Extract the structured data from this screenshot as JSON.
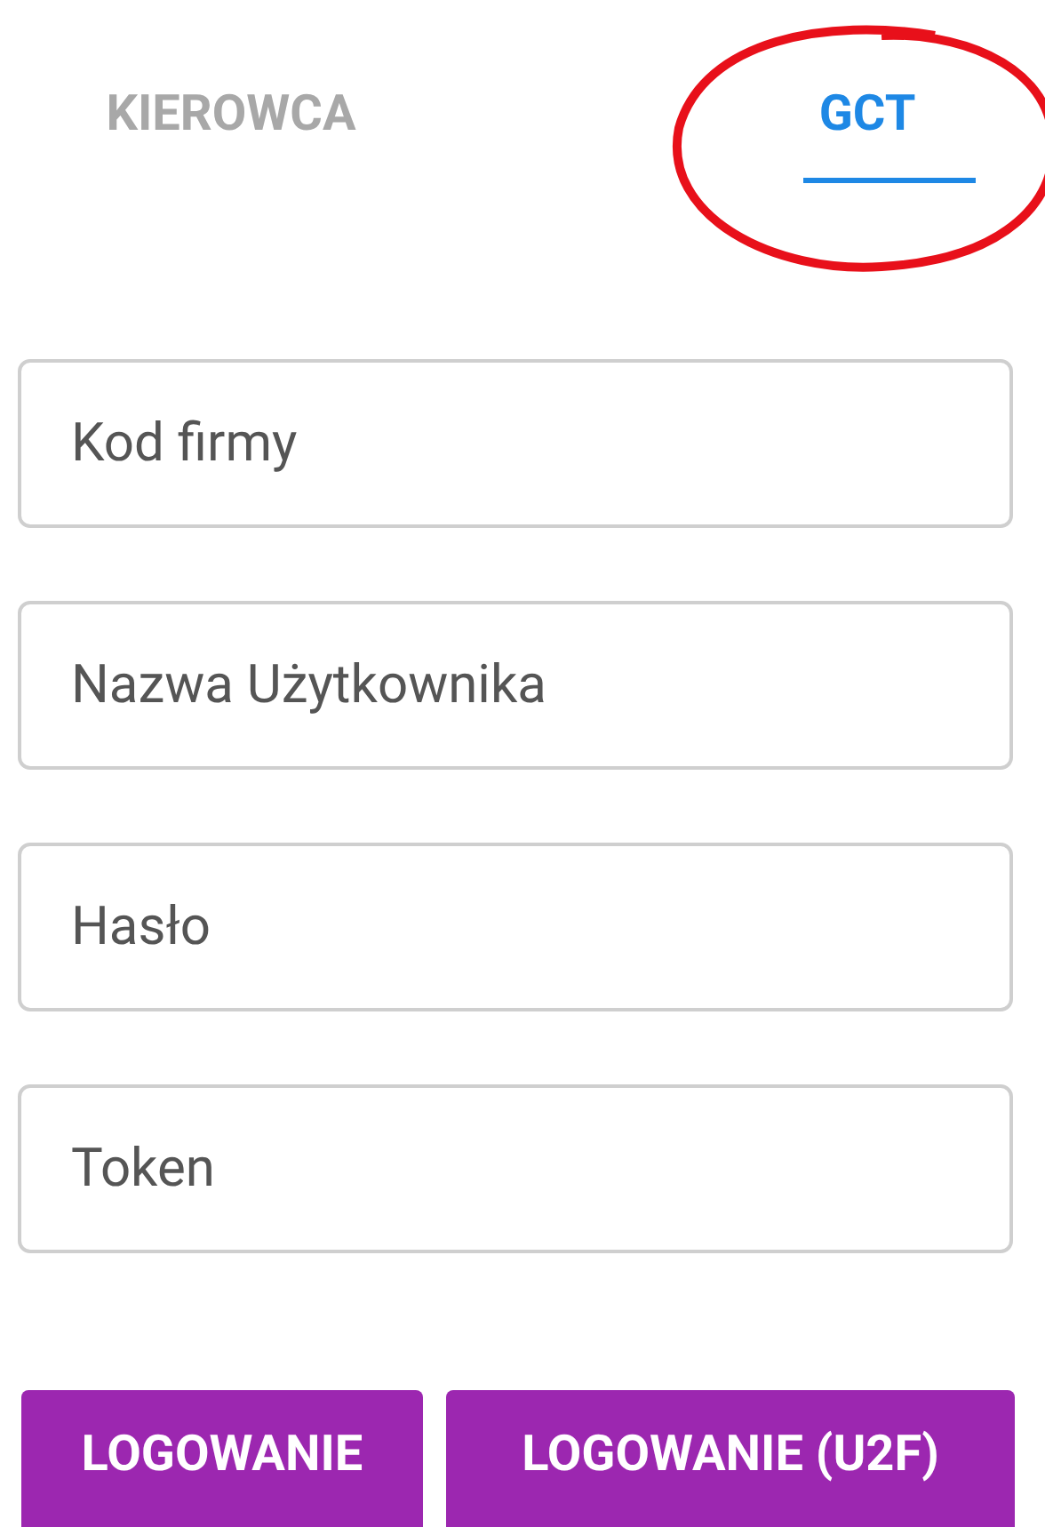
{
  "tabs": [
    {
      "label": "KIEROWCA",
      "selected": false
    },
    {
      "label": "GCT",
      "selected": true
    }
  ],
  "fields": [
    {
      "placeholder": "Kod firmy"
    },
    {
      "placeholder": "Nazwa Użytkownika"
    },
    {
      "placeholder": "Hasło"
    },
    {
      "placeholder": "Token"
    }
  ],
  "buttons": [
    "LOGOWANIE",
    "LOGOWANIE (U2F)"
  ]
}
